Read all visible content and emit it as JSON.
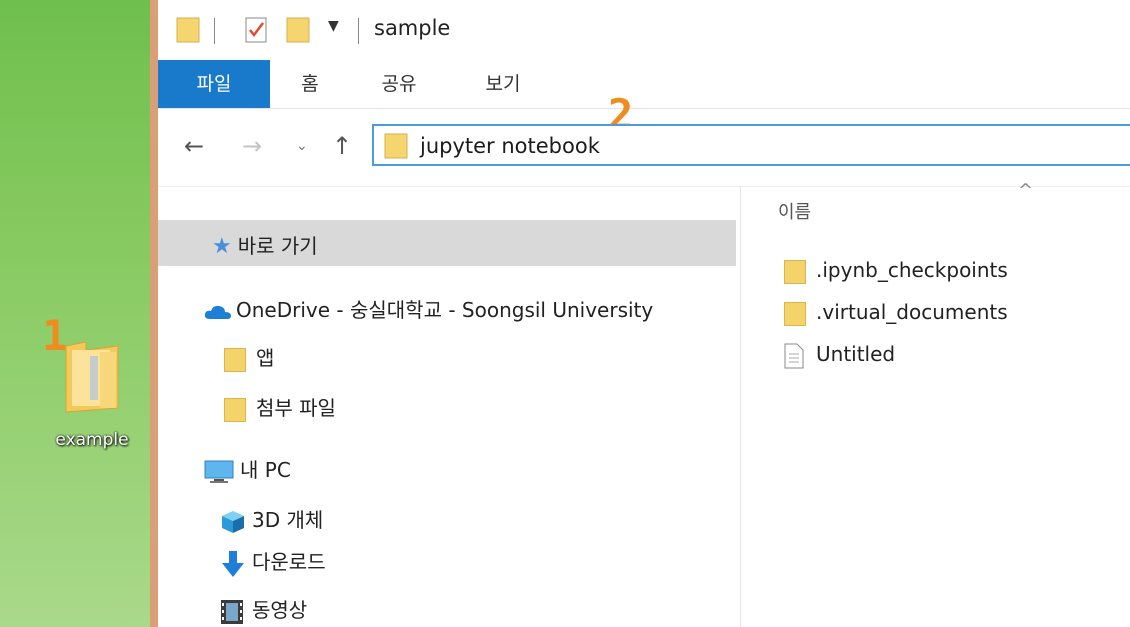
{
  "desktop": {
    "marker1": "1",
    "marker2": "2",
    "folder_label": "example"
  },
  "window": {
    "title": "sample",
    "tabs": [
      {
        "label": "파일",
        "active": true
      },
      {
        "label": "홈"
      },
      {
        "label": "공유"
      },
      {
        "label": "보기"
      }
    ],
    "address": "jupyter notebook",
    "nav": {
      "quick_access": "바로 가기",
      "onedrive": "OneDrive - 숭실대학교 - Soongsil University",
      "app": "앱",
      "attachments": "첨부 파일",
      "this_pc": "내 PC",
      "objects3d": "3D 개체",
      "downloads": "다운로드",
      "videos": "동영상"
    },
    "file_list": {
      "column_name": "이름",
      "items": [
        ".ipynb_checkpoints",
        ".virtual_documents",
        "Untitled"
      ]
    }
  },
  "colors": {
    "accent": "#1979ca",
    "marker": "#f08c1f",
    "desktop_green": "#85c95e"
  }
}
